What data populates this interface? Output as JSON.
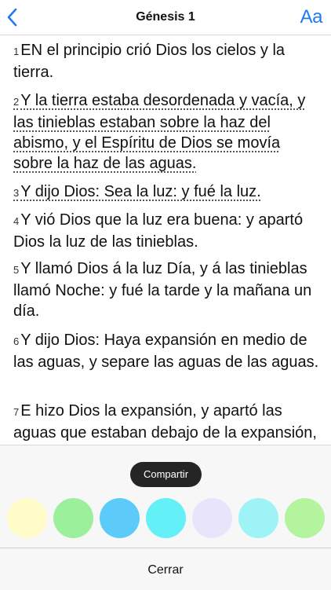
{
  "header": {
    "title": "Génesis 1",
    "back_icon": "chevron-left-icon",
    "font_label": "Aa",
    "accent": "#1e7bf0"
  },
  "verses": [
    {
      "num": "1",
      "text": "EN el principio crió Dios los cielos y la tierra."
    },
    {
      "num": "2",
      "text": "Y la tierra estaba desordenada y vacía, y las tinieblas estaban sobre la haz del abismo, y el Espíritu de Dios se movía sobre la haz de las aguas."
    },
    {
      "num": "3",
      "text": "Y dijo Dios: Sea la luz: y fué la luz."
    },
    {
      "num": "4",
      "text": "Y vió Dios que la luz era buena: y apartó Dios la luz de las tinieblas."
    },
    {
      "num": "5",
      "text": "Y llamó Dios á la luz Día, y á las tinieblas llamó Noche: y fué la tarde y la mañana un día."
    },
    {
      "num": "6",
      "text": "Y dijo Dios: Haya expansión en medio de las aguas, y separe las aguas de las aguas."
    },
    {
      "num": "7",
      "text": "E hizo Dios la expansión, y apartó las aguas que estaban debajo de la expansión, de las aguas que estaban"
    }
  ],
  "sheet": {
    "share_label": "Compartir",
    "highlight_colors": [
      "#fffbc8",
      "#9df09b",
      "#5ccbf9",
      "#63f0f6",
      "#e8e4fc",
      "#9df3f5",
      "#b5f49f"
    ],
    "close_label": "Cerrar"
  }
}
